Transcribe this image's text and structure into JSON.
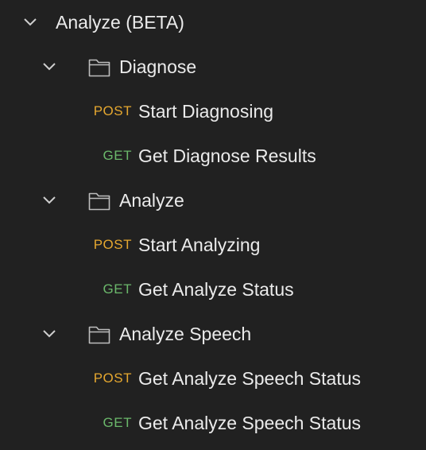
{
  "collection": {
    "title": "Analyze (BETA)",
    "folders": [
      {
        "name": "Diagnose",
        "requests": [
          {
            "method": "POST",
            "name": "Start Diagnosing"
          },
          {
            "method": "GET",
            "name": "Get Diagnose Results"
          }
        ]
      },
      {
        "name": "Analyze",
        "requests": [
          {
            "method": "POST",
            "name": "Start Analyzing"
          },
          {
            "method": "GET",
            "name": "Get Analyze Status"
          }
        ]
      },
      {
        "name": "Analyze Speech",
        "requests": [
          {
            "method": "POST",
            "name": "Get Analyze Speech Status"
          },
          {
            "method": "GET",
            "name": "Get Analyze Speech Status"
          }
        ]
      }
    ]
  },
  "colors": {
    "background": "#212121",
    "text": "#ebebeb",
    "post": "#e5a72f",
    "get": "#6bb86b",
    "icon": "#bdbdbd"
  }
}
